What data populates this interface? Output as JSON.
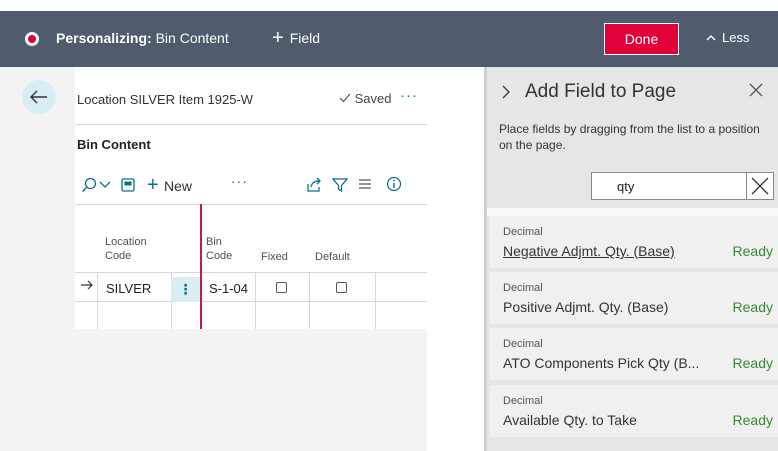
{
  "topbar": {
    "mode_label": "Personalizing:",
    "page_name": "Bin Content",
    "add_field_label": "Field",
    "done_label": "Done",
    "less_label": "Less"
  },
  "page": {
    "breadcrumb": "Location SILVER Item 1925-W",
    "saved_label": "Saved",
    "section_title": "Bin Content",
    "toolbar": {
      "new_label": "New"
    },
    "columns": [
      "Location Code",
      "Bin Code",
      "Fixed",
      "Default"
    ],
    "rows": [
      {
        "location_code": "SILVER",
        "bin_code": "S-1-04",
        "fixed": false,
        "default": false
      }
    ]
  },
  "pane": {
    "title": "Add Field to Page",
    "hint": "Place fields by dragging from the list to a position on the page.",
    "search_value": "qty",
    "fields": [
      {
        "type": "Decimal",
        "name": "Negative Adjmt. Qty. (Base)",
        "status": "Ready"
      },
      {
        "type": "Decimal",
        "name": "Positive Adjmt. Qty. (Base)",
        "status": "Ready"
      },
      {
        "type": "Decimal",
        "name": "ATO Components Pick Qty (B...",
        "status": "Ready"
      },
      {
        "type": "Decimal",
        "name": "Available Qty. to Take",
        "status": "Ready"
      }
    ]
  },
  "colors": {
    "topbar": "#505c6d",
    "accent_red": "#e0003a",
    "link_blue": "#0a6d93",
    "ready_green": "#338c33"
  }
}
